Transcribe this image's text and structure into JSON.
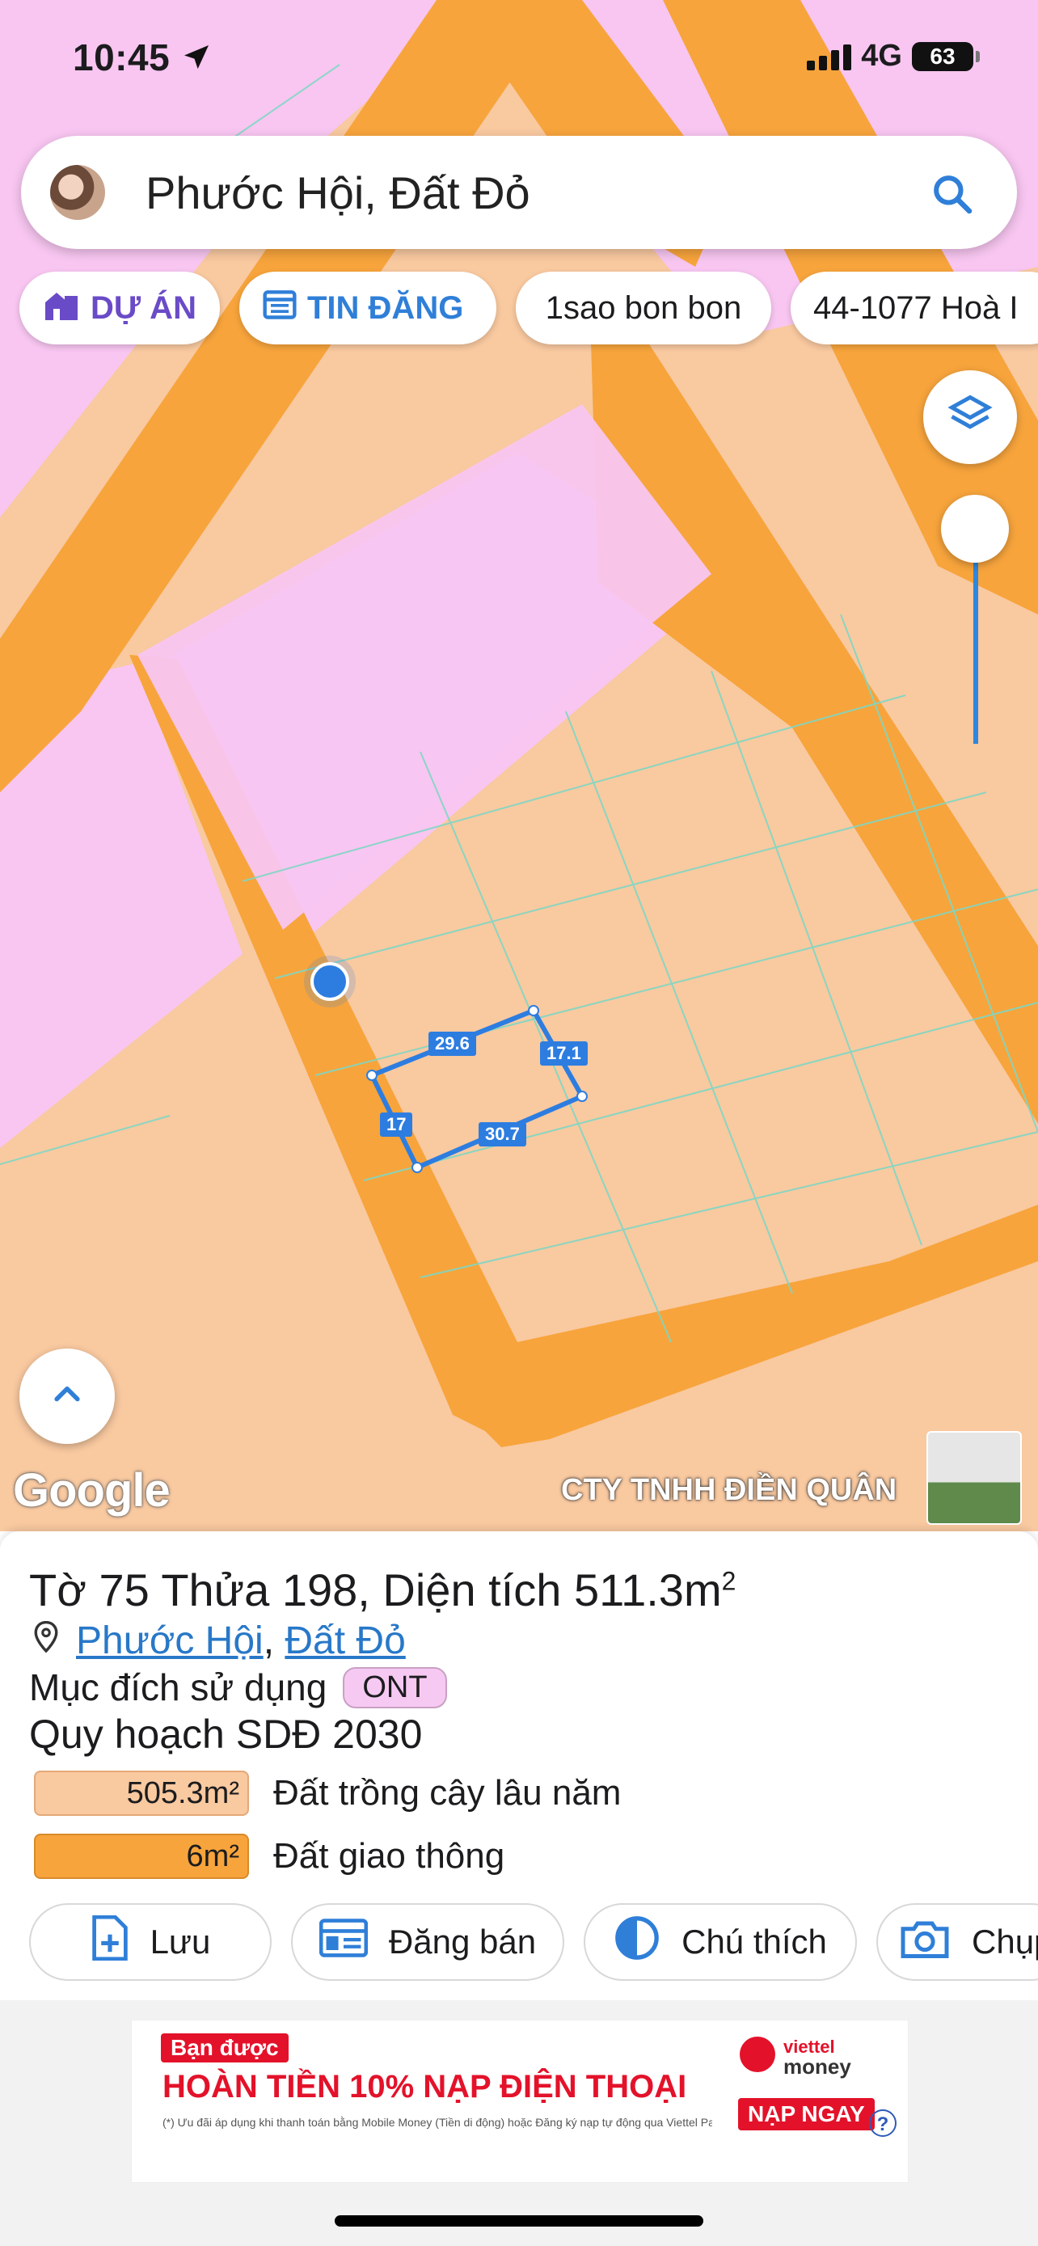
{
  "status_bar": {
    "time": "10:45",
    "network": "4G",
    "battery": "63"
  },
  "search": {
    "query": "Phước Hội, Đất Đỏ"
  },
  "chips": [
    {
      "label": "DỰ ÁN",
      "icon": "house-icon"
    },
    {
      "label": "TIN ĐĂNG",
      "icon": "calendar-icon"
    },
    {
      "label": "1sao bon bon"
    },
    {
      "label": "44-1077 Hoà I"
    }
  ],
  "map": {
    "google_logo": "Google",
    "company_label": "CTY TNHH ĐIỀN QUÂN",
    "edge_lengths": [
      "29.6",
      "17.1",
      "17",
      "30.7"
    ],
    "colors": {
      "residential": "#f9c9a0",
      "road": "#f7a43c",
      "other": "#f8c6f1"
    }
  },
  "parcel": {
    "title_prefix": "Tờ 75 Thửa 198, Diện tích 511.3m",
    "title_sup": "2",
    "ward": "Phước Hội",
    "separator": ",",
    "district": "Đất Đỏ",
    "purpose_label": "Mục đích sử dụng",
    "purpose_code": "ONT",
    "plan_title": "Quy hoạch SDĐ 2030",
    "plan_items": [
      {
        "area": "505.3m²",
        "label": "Đất trồng cây lâu năm",
        "color": "#f9c9a0"
      },
      {
        "area": "6m²",
        "label": "Đất giao thông",
        "color": "#f7a43c"
      }
    ]
  },
  "actions": [
    {
      "label": "Lưu",
      "icon": "add-file-icon"
    },
    {
      "label": "Đăng bán",
      "icon": "listing-icon"
    },
    {
      "label": "Chú thích",
      "icon": "contrast-icon"
    },
    {
      "label": "Chụp",
      "icon": "camera-icon"
    }
  ],
  "ad": {
    "kicker": "Bạn được",
    "headline": "HOÀN TIỀN 10% NẠP ĐIỆN THOẠI",
    "fineprint": "(*) Ưu đãi áp dụng khi thanh toán bằng Mobile Money (Tiền di động) hoặc Đăng ký nạp tự động qua Viettel Pay",
    "brand_top": "viettel",
    "brand_bottom": "money",
    "cta": "NẠP NGAY"
  }
}
